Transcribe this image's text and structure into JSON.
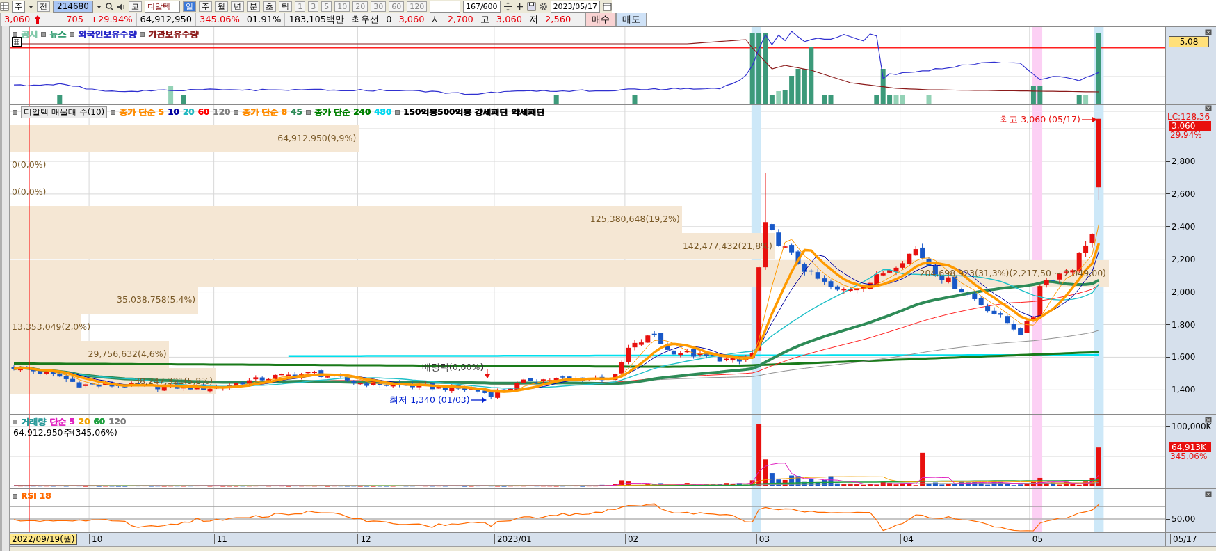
{
  "toolbar": {
    "view": "주",
    "range": "전",
    "code": "214680",
    "market": "코",
    "stock_name": "디알텍",
    "periods": [
      {
        "label": "일",
        "selected": true
      },
      {
        "label": "주",
        "selected": false
      },
      {
        "label": "월",
        "selected": false
      },
      {
        "label": "년",
        "selected": false
      },
      {
        "label": "분",
        "selected": false
      },
      {
        "label": "초",
        "selected": false
      },
      {
        "label": "틱",
        "selected": false
      }
    ],
    "intervals": [
      "1",
      "3",
      "5",
      "10",
      "20",
      "30",
      "60",
      "120"
    ],
    "count": "167/600",
    "date": "2023/05/17"
  },
  "quote": {
    "items": [
      {
        "text": "3,060",
        "kind": "up"
      },
      {
        "text": "705",
        "kind": "up"
      },
      {
        "text": "+29.94%",
        "kind": "up"
      },
      {
        "text": "64,912,950",
        "kind": "plain"
      },
      {
        "text": "345.06%",
        "kind": "up"
      },
      {
        "text": "01.91%",
        "kind": "plain"
      },
      {
        "text": "183,105백만",
        "kind": "plain"
      },
      {
        "text": "최우선",
        "kind": "plain"
      },
      {
        "text": "0",
        "kind": "plain"
      },
      {
        "text": "3,060",
        "kind": "up"
      },
      {
        "text": "시",
        "kind": "plain"
      },
      {
        "text": "2,700",
        "kind": "up"
      },
      {
        "text": "고",
        "kind": "plain"
      },
      {
        "text": "3,060",
        "kind": "up"
      },
      {
        "text": "저",
        "kind": "plain"
      },
      {
        "text": "2,560",
        "kind": "up"
      }
    ],
    "buttons": [
      {
        "label": "매수",
        "kind": "buy"
      },
      {
        "label": "매도",
        "kind": "sell"
      }
    ]
  },
  "investor_pane": {
    "legend": [
      {
        "items": [
          {
            "label": "공시",
            "color": "#7fc8a8"
          }
        ]
      },
      {
        "items": [
          {
            "label": "뉴스",
            "color": "#2e9a6e"
          }
        ]
      },
      {
        "items": [
          {
            "label": "외국인보유수량",
            "color": "#2828c8"
          }
        ]
      },
      {
        "items": [
          {
            "label": "기관보유수량",
            "color": "#8b1a1a"
          }
        ]
      }
    ],
    "axis_badge": "5,08"
  },
  "price_pane": {
    "indicator": "디알텍 매물대 수(10)",
    "legend": [
      {
        "items": [
          {
            "label": "종가 단순 5",
            "color": "#ff8c00"
          },
          {
            "label": "10",
            "color": "#0000a0"
          },
          {
            "label": "20",
            "color": "#20b8c0"
          },
          {
            "label": "60",
            "color": "#ff0000"
          },
          {
            "label": "120",
            "color": "#808080"
          }
        ]
      },
      {
        "items": [
          {
            "label": "종가 단순 8",
            "color": "#ff8c00"
          },
          {
            "label": "45",
            "color": "#2e8b57"
          }
        ]
      },
      {
        "items": [
          {
            "label": "종가 단순 240",
            "color": "#008000"
          },
          {
            "label": "480",
            "color": "#00d8f0"
          }
        ]
      },
      {
        "items": [
          {
            "label": "150억봉500억봉 강세패턴",
            "color": "#000000"
          },
          {
            "label": "약세패턴",
            "color": "#000000"
          }
        ]
      }
    ],
    "volume_profile": [
      {
        "label": "64,912,950(9,9%)",
        "level": 0.302
      },
      {
        "label": "0(0,0%)"
      },
      {
        "label": "0(0,0%)"
      },
      {
        "label": "125,380,648(19,2%)",
        "level": 0.582
      },
      {
        "label": "142,477,432(21,8%)",
        "level": 0.662
      },
      {
        "label": "204,698,923(31,3%)(2,217,50 ~ 2,049,00)",
        "level": 0.951
      },
      {
        "label": "35,038,758(5,4%)",
        "level": 0.163
      },
      {
        "label": "13,353,049(2,0%)",
        "level": 0.062
      },
      {
        "label": "29,756,632(4,6%)",
        "level": 0.138
      },
      {
        "label": "38,247,321(5,8%)",
        "level": 0.178
      }
    ],
    "annotations": [
      {
        "kind": "high",
        "text": "최고 3,060 (05/17)"
      },
      {
        "kind": "dividend",
        "text": "배당락(0,00%)"
      },
      {
        "kind": "low",
        "text": "최저 1,340 (01/03)"
      }
    ],
    "axis": {
      "lc": "LC:128,36",
      "price_badge": "3,060",
      "change": "29,94%",
      "ticks": [
        "2,800",
        "2,600",
        "2,400",
        "2,200",
        "2,000",
        "1,800",
        "1,600",
        "1,400"
      ]
    }
  },
  "volume_pane": {
    "legend": [
      {
        "items": [
          {
            "label": "거래량",
            "color": "#2a9a9a"
          },
          {
            "label": "단순 5",
            "color": "#e020c0"
          },
          {
            "label": "20",
            "color": "#f0a000"
          },
          {
            "label": "60",
            "color": "#20a040"
          },
          {
            "label": "120",
            "color": "#808080"
          }
        ]
      }
    ],
    "summary": "64,912,950주(345,06%)",
    "axis": {
      "tick": "100,000K",
      "badge": "64,913K",
      "change": "345,06%"
    }
  },
  "rsi_pane": {
    "legend": [
      {
        "items": [
          {
            "label": "RSI 18",
            "color": "#ff6a00"
          }
        ]
      }
    ],
    "axis": {
      "tick": "50,00"
    }
  },
  "x_axis": {
    "start": "2022/09/19(월)",
    "months": [
      "10",
      "11",
      "12",
      "2023/01",
      "02",
      "03",
      "04",
      "05"
    ],
    "end": "05/17"
  }
}
